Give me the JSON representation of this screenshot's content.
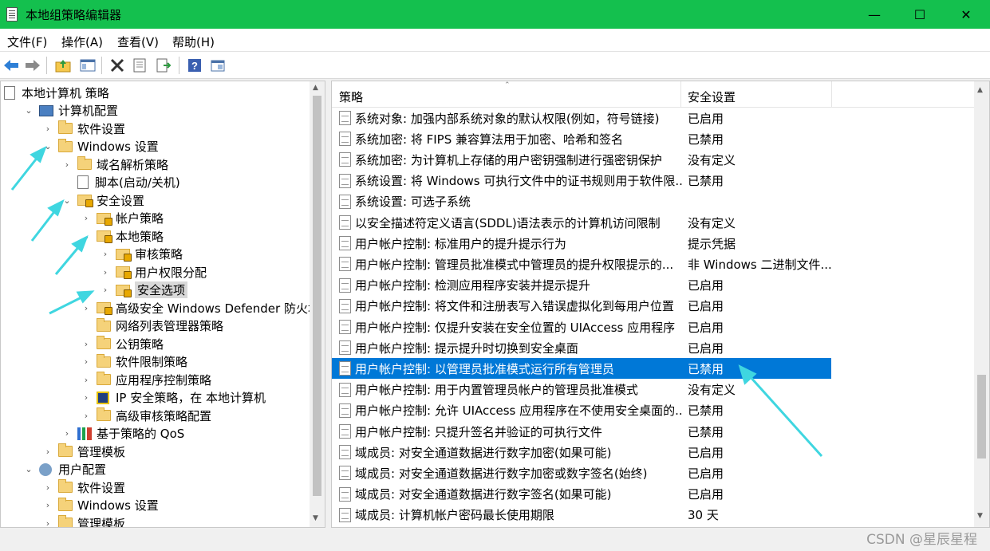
{
  "window": {
    "title": "本地组策略编辑器",
    "minimize": "—",
    "maximize": "☐",
    "close": "✕"
  },
  "menu": [
    {
      "label": "文件(F)"
    },
    {
      "label": "操作(A)"
    },
    {
      "label": "查看(V)"
    },
    {
      "label": "帮助(H)"
    }
  ],
  "toolbar": {
    "back": "back-arrow-icon",
    "forward": "forward-arrow-icon",
    "up": "up-folder-icon",
    "show_hide": "console-tree-icon",
    "delete": "delete-icon",
    "properties": "properties-icon",
    "export": "export-list-icon",
    "help": "help-icon",
    "view": "view-icon"
  },
  "tree": [
    {
      "label": "本地计算机 策略",
      "indent": 0,
      "arrow": "",
      "icon": "doc"
    },
    {
      "label": "计算机配置",
      "indent": 1,
      "arrow": "⌄",
      "icon": "pc"
    },
    {
      "label": "软件设置",
      "indent": 2,
      "arrow": "›",
      "icon": "folder"
    },
    {
      "label": "Windows 设置",
      "indent": 2,
      "arrow": "⌄",
      "icon": "folder"
    },
    {
      "label": "域名解析策略",
      "indent": 3,
      "arrow": "›",
      "icon": "folder"
    },
    {
      "label": "脚本(启动/关机)",
      "indent": 3,
      "arrow": "",
      "icon": "doc"
    },
    {
      "label": "安全设置",
      "indent": 3,
      "arrow": "⌄",
      "icon": "lock"
    },
    {
      "label": "帐户策略",
      "indent": 4,
      "arrow": "›",
      "icon": "lock"
    },
    {
      "label": "本地策略",
      "indent": 4,
      "arrow": "⌄",
      "icon": "lock"
    },
    {
      "label": "审核策略",
      "indent": 5,
      "arrow": "›",
      "icon": "lock"
    },
    {
      "label": "用户权限分配",
      "indent": 5,
      "arrow": "›",
      "icon": "lock"
    },
    {
      "label": "安全选项",
      "indent": 5,
      "arrow": "›",
      "icon": "lock",
      "selected": true
    },
    {
      "label": "高级安全 Windows Defender 防火墙",
      "indent": 4,
      "arrow": "›",
      "icon": "lock"
    },
    {
      "label": "网络列表管理器策略",
      "indent": 4,
      "arrow": "",
      "icon": "folder"
    },
    {
      "label": "公钥策略",
      "indent": 4,
      "arrow": "›",
      "icon": "folder"
    },
    {
      "label": "软件限制策略",
      "indent": 4,
      "arrow": "›",
      "icon": "folder"
    },
    {
      "label": "应用程序控制策略",
      "indent": 4,
      "arrow": "›",
      "icon": "folder"
    },
    {
      "label": "IP 安全策略，在 本地计算机",
      "indent": 4,
      "arrow": "›",
      "icon": "ip"
    },
    {
      "label": "高级审核策略配置",
      "indent": 4,
      "arrow": "›",
      "icon": "folder"
    },
    {
      "label": "基于策略的 QoS",
      "indent": 3,
      "arrow": "›",
      "icon": "qos"
    },
    {
      "label": "管理模板",
      "indent": 2,
      "arrow": "›",
      "icon": "folder"
    },
    {
      "label": "用户配置",
      "indent": 1,
      "arrow": "⌄",
      "icon": "user"
    },
    {
      "label": "软件设置",
      "indent": 2,
      "arrow": "›",
      "icon": "folder"
    },
    {
      "label": "Windows 设置",
      "indent": 2,
      "arrow": "›",
      "icon": "folder"
    },
    {
      "label": "管理模板",
      "indent": 2,
      "arrow": "›",
      "icon": "folder"
    }
  ],
  "columns": {
    "policy": "策略",
    "setting": "安全设置"
  },
  "policies": [
    {
      "name": "系统对象: 加强内部系统对象的默认权限(例如，符号链接)",
      "value": "已启用"
    },
    {
      "name": "系统加密: 将 FIPS 兼容算法用于加密、哈希和签名",
      "value": "已禁用"
    },
    {
      "name": "系统加密: 为计算机上存储的用户密钥强制进行强密钥保护",
      "value": "没有定义"
    },
    {
      "name": "系统设置: 将 Windows 可执行文件中的证书规则用于软件限...",
      "value": "已禁用"
    },
    {
      "name": "系统设置: 可选子系统",
      "value": ""
    },
    {
      "name": "以安全描述符定义语言(SDDL)语法表示的计算机访问限制",
      "value": "没有定义"
    },
    {
      "name": "用户帐户控制: 标准用户的提升提示行为",
      "value": "提示凭据"
    },
    {
      "name": "用户帐户控制: 管理员批准模式中管理员的提升权限提示的...",
      "value": "非 Windows 二进制文件..."
    },
    {
      "name": "用户帐户控制: 检测应用程序安装并提示提升",
      "value": "已启用"
    },
    {
      "name": "用户帐户控制: 将文件和注册表写入错误虚拟化到每用户位置",
      "value": "已启用"
    },
    {
      "name": "用户帐户控制: 仅提升安装在安全位置的 UIAccess 应用程序",
      "value": "已启用"
    },
    {
      "name": "用户帐户控制: 提示提升时切换到安全桌面",
      "value": "已启用"
    },
    {
      "name": "用户帐户控制: 以管理员批准模式运行所有管理员",
      "value": "已禁用",
      "selected": true
    },
    {
      "name": "用户帐户控制: 用于内置管理员帐户的管理员批准模式",
      "value": "没有定义"
    },
    {
      "name": "用户帐户控制: 允许 UIAccess 应用程序在不使用安全桌面的...",
      "value": "已禁用"
    },
    {
      "name": "用户帐户控制: 只提升签名并验证的可执行文件",
      "value": "已禁用"
    },
    {
      "name": "域成员: 对安全通道数据进行数字加密(如果可能)",
      "value": "已启用"
    },
    {
      "name": "域成员: 对安全通道数据进行数字加密或数字签名(始终)",
      "value": "已启用"
    },
    {
      "name": "域成员: 对安全通道数据进行数字签名(如果可能)",
      "value": "已启用"
    },
    {
      "name": "域成员: 计算机帐户密码最长使用期限",
      "value": "30 天"
    }
  ],
  "watermark": "CSDN @星辰星程",
  "colors": {
    "titlebar": "#14c04e",
    "selection": "#0078d7",
    "annotation_arrow": "#3fd6e0"
  }
}
